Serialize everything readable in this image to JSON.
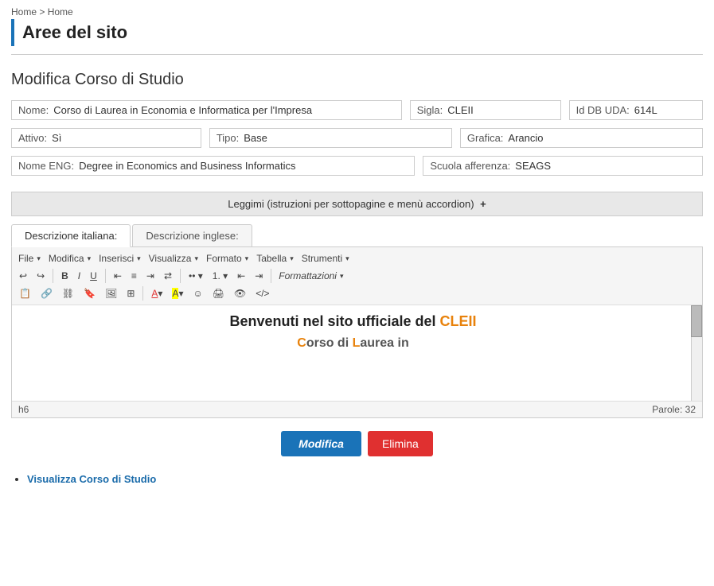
{
  "breadcrumb": {
    "items": [
      "Home >",
      "Home"
    ]
  },
  "page_title": "Aree del sito",
  "form": {
    "section_title": "Modifica Corso di Studio",
    "fields": {
      "nome_label": "Nome:",
      "nome_value": "Corso di Laurea in Economia e Informatica per l'Impresa",
      "sigla_label": "Sigla:",
      "sigla_value": "CLEII",
      "id_db_uda_label": "Id DB UDA:",
      "id_db_uda_value": "614L",
      "attivo_label": "Attivo:",
      "attivo_value": "Sì",
      "tipo_label": "Tipo:",
      "tipo_value": "Base",
      "grafica_label": "Grafica:",
      "grafica_value": "Arancio",
      "nome_eng_label": "Nome ENG:",
      "nome_eng_value": "Degree in Economics and Business Informatics",
      "scuola_label": "Scuola afferenza:",
      "scuola_value": "SEAGS"
    }
  },
  "leggimi": {
    "text": "Leggimi",
    "subtext": "(istruzioni per sottopagine e menù accordion)",
    "plus": "+"
  },
  "tabs": [
    {
      "label": "Descrizione italiana:",
      "active": true
    },
    {
      "label": "Descrizione inglese:",
      "active": false
    }
  ],
  "toolbar": {
    "menus": [
      "File",
      "Modifica",
      "Inserisci",
      "Visualizza",
      "Formato",
      "Tabella",
      "Strumenti"
    ],
    "format_dropdown": "Formattazioni"
  },
  "editor": {
    "welcome_part1": "Benvenuti nel sito ufficiale del ",
    "welcome_orange": "CLEII",
    "sub_text1": "C",
    "sub_text2": "orso di ",
    "sub_text3": "L",
    "sub_text4": "aurea in"
  },
  "status_bar": {
    "element": "h6",
    "word_count_label": "Parole:",
    "word_count": "32"
  },
  "buttons": {
    "modifica": "Modifica",
    "elimina": "Elimina"
  },
  "footer_links": [
    {
      "label": "Visualizza Corso di Studio",
      "href": "#"
    }
  ]
}
